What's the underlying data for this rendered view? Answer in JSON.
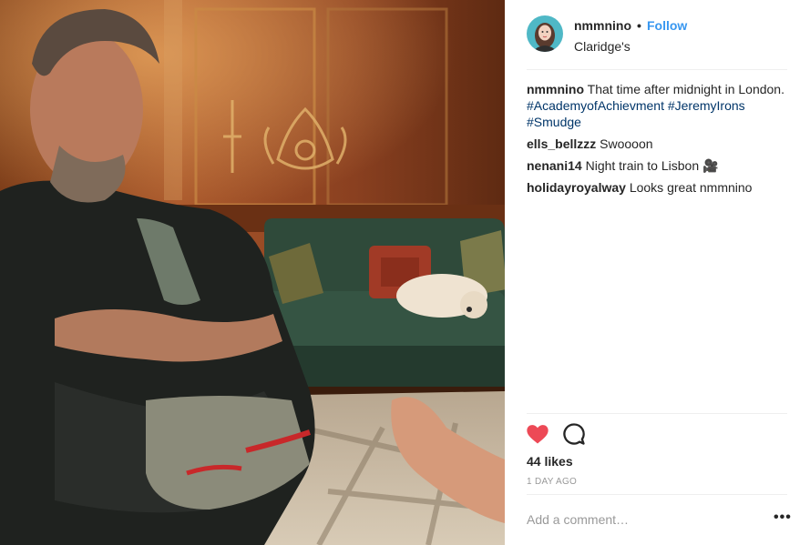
{
  "post": {
    "username": "nmmnino",
    "separator": "•",
    "follow_label": "Follow",
    "location": "Claridge's",
    "photo_icon": "post-photo",
    "avatar_icon": "user-avatar"
  },
  "comments": [
    {
      "user": "nmmnino",
      "text": "That time after midnight in London.",
      "tags": [
        "#AcademyofAchievment",
        "#JeremyIrons",
        "#Smudge"
      ]
    },
    {
      "user": "ells_bellzzz",
      "text": "Swoooon"
    },
    {
      "user": "nenani14",
      "text": "Night train to Lisbon 🎥"
    },
    {
      "user": "holidayroyalway",
      "text": "Looks great nmmnino"
    }
  ],
  "actions": {
    "like_icon": "heart-icon",
    "comment_icon": "comment-icon",
    "liked": true,
    "heart_color": "#ed4956"
  },
  "likes_text": "44 likes",
  "timestamp": "1 DAY AGO",
  "add_comment_placeholder": "Add a comment…",
  "more_label": "•••"
}
